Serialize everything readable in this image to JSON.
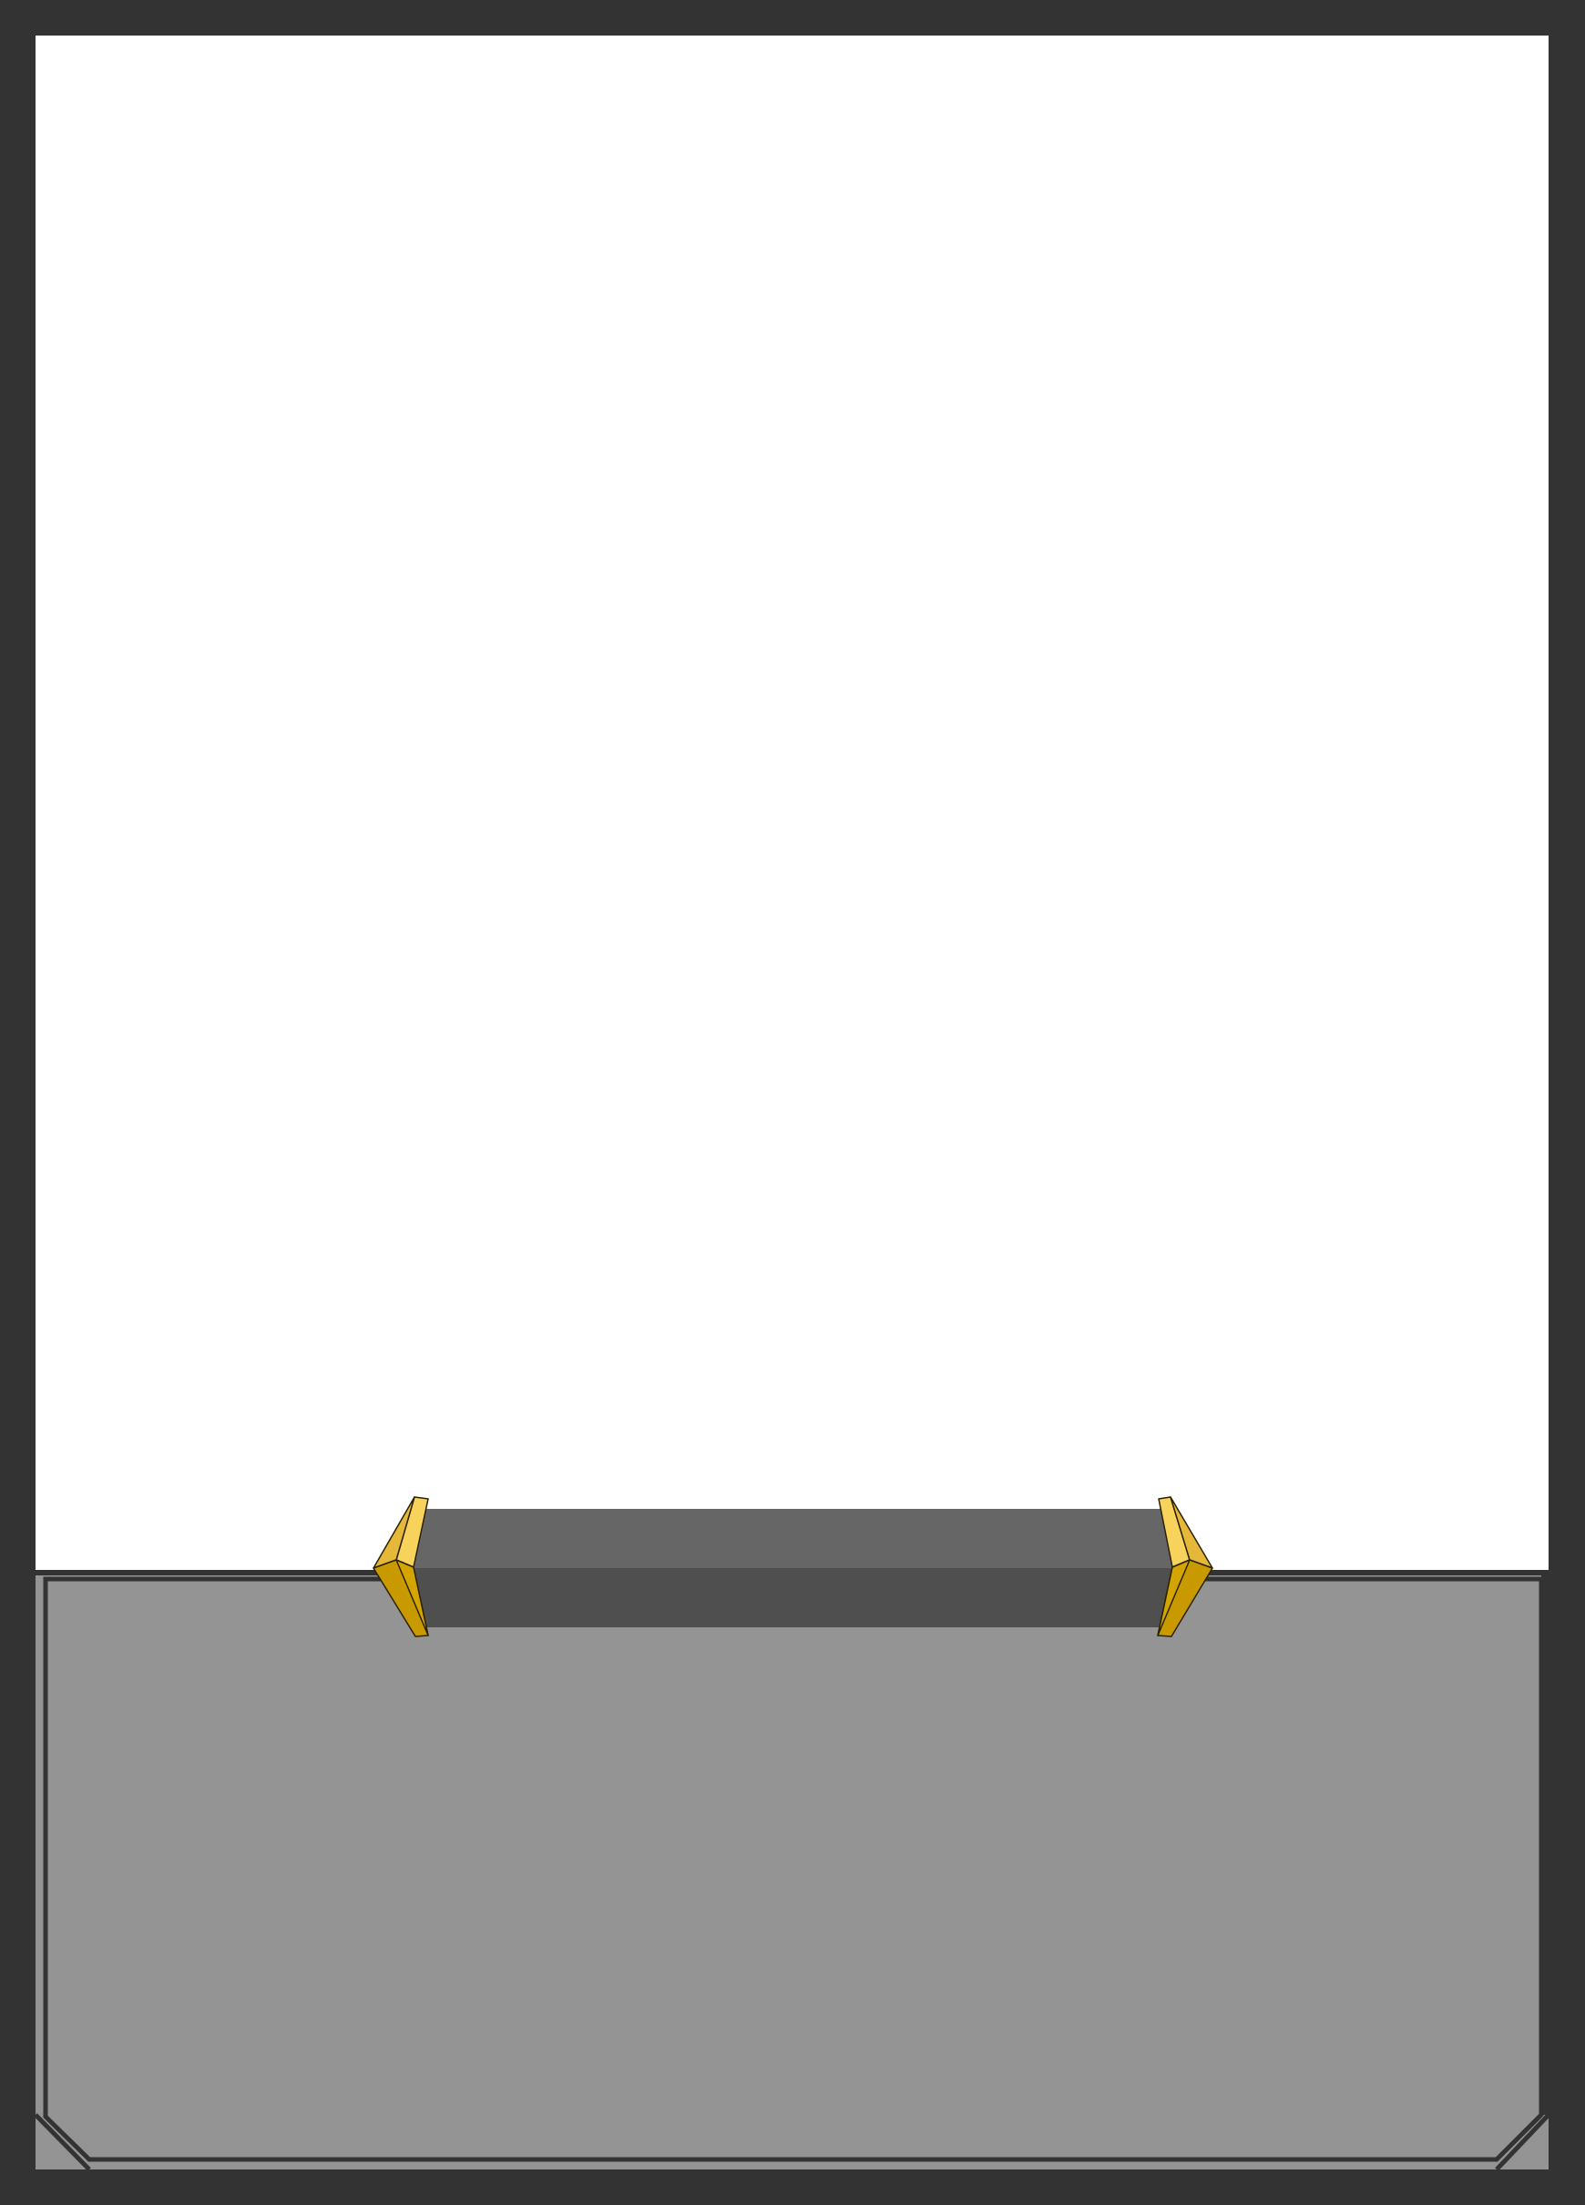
{
  "card": {
    "title": "",
    "body_text": "",
    "colors": {
      "frame": "#333333",
      "art_area": "#ffffff",
      "text_box": "#949494",
      "banner_top": "#666666",
      "banner_bottom": "#4f4f4f",
      "gem_light": "#f7d35c",
      "gem_mid": "#e6b83a",
      "gem_dark": "#c99a00"
    },
    "icons": {
      "left_ornament": "gold-gem-icon",
      "right_ornament": "gold-gem-icon"
    }
  }
}
